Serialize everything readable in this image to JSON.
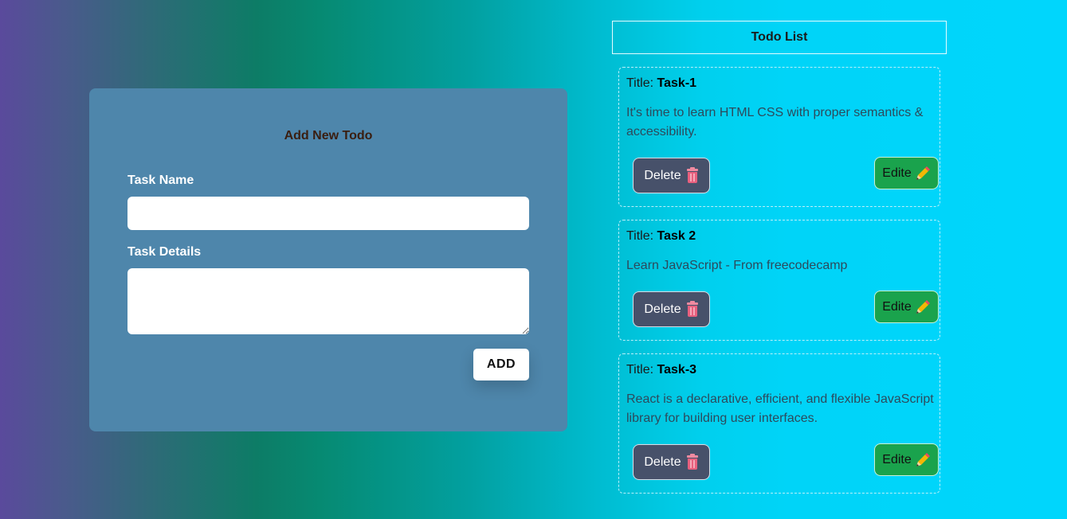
{
  "form": {
    "title": "Add New Todo",
    "task_name_label": "Task Name",
    "task_name_value": "",
    "task_details_label": "Task Details",
    "task_details_value": "",
    "add_label": "ADD"
  },
  "list": {
    "header": "Todo List",
    "title_prefix": "Title:",
    "delete_label": "Delete",
    "edit_label": "Edite",
    "items": [
      {
        "title": "Task-1",
        "description": "It's time to learn HTML CSS with proper semantics & accessibility."
      },
      {
        "title": "Task 2",
        "description": "Learn JavaScript - From freecodecamp"
      },
      {
        "title": "Task-3",
        "description": "React is a declarative, efficient, and flexible JavaScript library for building user interfaces."
      }
    ]
  },
  "icons": {
    "delete": "trash-icon",
    "edit": "pencil-icon"
  },
  "colors": {
    "form_card": "#4e86ab",
    "delete_button": "#47516a",
    "edit_button": "#1aa34d",
    "add_button": "#ffffff"
  }
}
